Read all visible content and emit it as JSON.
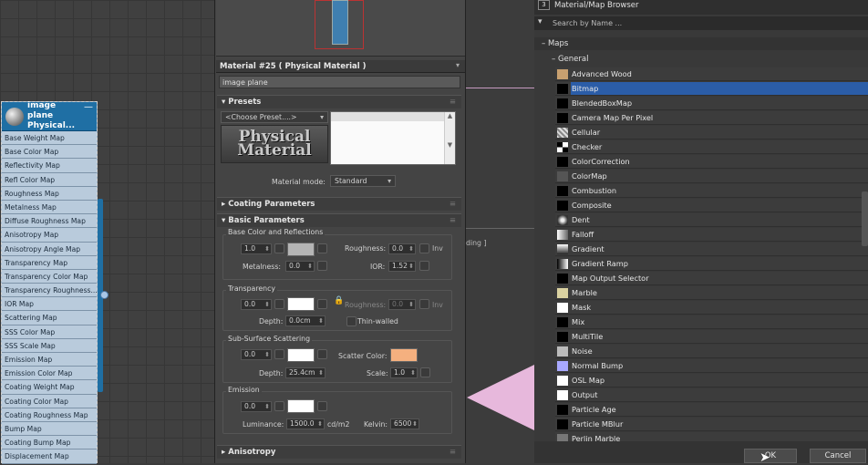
{
  "node": {
    "title": "image plane Physical...",
    "collapse": "—",
    "slots": [
      "Base Weight Map",
      "Base Color Map",
      "Reflectivity Map",
      "Refl Color Map",
      "Roughness Map",
      "Metalness Map",
      "Diffuse Roughness Map",
      "Anisotropy Map",
      "Anisotropy Angle Map",
      "Transparency Map",
      "Transparency Color Map",
      "Transparency Roughness...",
      "IOR Map",
      "Scattering Map",
      "SSS Color Map",
      "SSS Scale Map",
      "Emission Map",
      "Emission Color Map",
      "Coating Weight Map",
      "Coating Color Map",
      "Coating Roughness Map",
      "Bump Map",
      "Coating Bump Map",
      "Displacement Map"
    ]
  },
  "material": {
    "header": "Material #25  ( Physical Material )",
    "name": "image plane",
    "presets_title": "Presets",
    "preset_choice": "<Choose Preset....>",
    "logo_text": "Physical Material",
    "mode_label": "Material mode:",
    "mode_value": "Standard",
    "coating_title": "Coating Parameters",
    "basic_title": "Basic Parameters",
    "anisotropy_title": "Anisotropy",
    "base": {
      "title": "Base Color and Reflections",
      "weight": "1.0",
      "roughness_label": "Roughness:",
      "roughness": "0.0",
      "inv_label": "Inv",
      "metalness_label": "Metalness:",
      "metalness": "0.0",
      "ior_label": "IOR:",
      "ior": "1.52"
    },
    "transparency": {
      "title": "Transparency",
      "weight": "0.0",
      "roughness_label": "Roughness:",
      "roughness": "0.0",
      "inv_label": "Inv",
      "depth_label": "Depth:",
      "depth": "0.0cm",
      "thin_label": "Thin-walled"
    },
    "sss": {
      "title": "Sub-Surface Scattering",
      "weight": "0.0",
      "scatter_label": "Scatter Color:",
      "depth_label": "Depth:",
      "depth": "25.4cm",
      "scale_label": "Scale:",
      "scale": "1.0"
    },
    "emission": {
      "title": "Emission",
      "weight": "0.0",
      "luminance_label": "Luminance:",
      "luminance": "1500.0",
      "unit": "cd/m2",
      "kelvin_label": "Kelvin:",
      "kelvin": "6500"
    }
  },
  "viewport": {
    "label": "ding ]"
  },
  "browser": {
    "title": "Material/Map Browser",
    "search_placeholder": "Search by Name ...",
    "maps_label": "Maps",
    "general_label": "General",
    "items": [
      "Advanced Wood",
      "Bitmap",
      "BlendedBoxMap",
      "Camera Map Per Pixel",
      "Cellular",
      "Checker",
      "ColorCorrection",
      "ColorMap",
      "Combustion",
      "Composite",
      "Dent",
      "Falloff",
      "Gradient",
      "Gradient Ramp",
      "Map Output Selector",
      "Marble",
      "Mask",
      "Mix",
      "MultiTile",
      "Noise",
      "Normal Bump",
      "OSL Map",
      "Output",
      "Particle Age",
      "Particle MBlur",
      "Perlin Marble"
    ],
    "selected": "Bitmap",
    "ok_label": "OK",
    "cancel_label": "Cancel"
  },
  "colors": {
    "node_header": "#1f6fa4",
    "selection": "#2b5da8",
    "scatter_color": "#f5b07f",
    "viewport_pink": "#e7b8dc"
  }
}
